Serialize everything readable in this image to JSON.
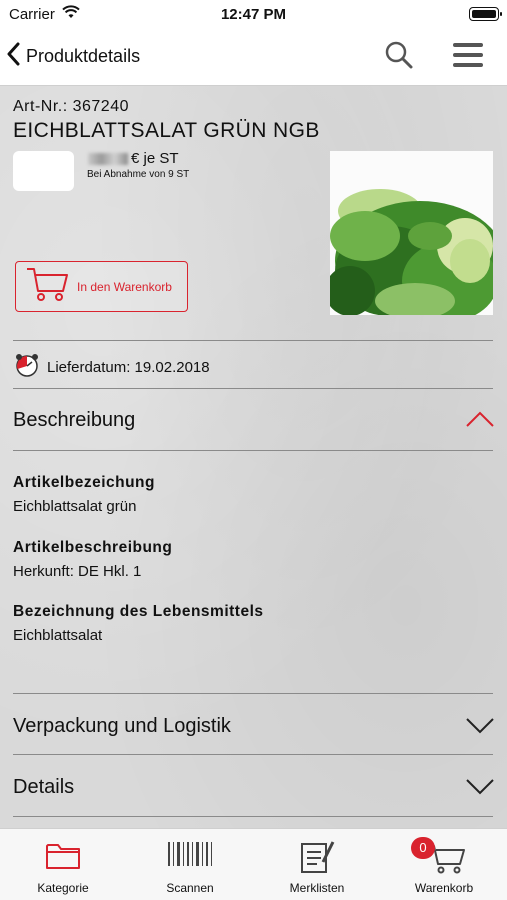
{
  "statusbar": {
    "carrier": "Carrier",
    "time": "12:47 PM"
  },
  "navbar": {
    "back_label": "Produktdetails",
    "icons": [
      "chevron-left-icon",
      "search-icon",
      "hamburger-menu-icon"
    ]
  },
  "product": {
    "article_number": "Art-Nr.: 367240",
    "title": "EICHBLATTSALAT GRÜN NGB",
    "price_suffix": "€ je ST",
    "min_quantity": "Bei Abnahme von 9 ST",
    "cart_button_label": "In den Warenkorb",
    "delivery_label": "Lieferdatum: 19.02.2018"
  },
  "sections": {
    "description": {
      "title": "Beschreibung",
      "expanded": true,
      "fields": [
        {
          "label": "Artikelbezeichung",
          "value": "Eichblattsalat grün"
        },
        {
          "label": "Artikelbeschreibung",
          "value": "Herkunft: DE Hkl. 1"
        },
        {
          "label": "Bezeichnung des Lebensmittels",
          "value": "Eichblattsalat"
        }
      ]
    },
    "packaging": {
      "title": "Verpackung und Logistik",
      "expanded": false
    },
    "details": {
      "title": "Details",
      "expanded": false
    }
  },
  "tabbar": {
    "tabs": [
      {
        "label": "Kategorie",
        "icon": "folder-icon",
        "active": true
      },
      {
        "label": "Scannen",
        "icon": "barcode-icon",
        "active": false
      },
      {
        "label": "Merklisten",
        "icon": "notepad-icon",
        "active": false
      },
      {
        "label": "Warenkorb",
        "icon": "cart-icon",
        "active": false
      }
    ],
    "cart_badge": "0"
  },
  "colors": {
    "accent": "#d9232e",
    "background": "#d9d9d9",
    "bar": "#ffffff"
  }
}
